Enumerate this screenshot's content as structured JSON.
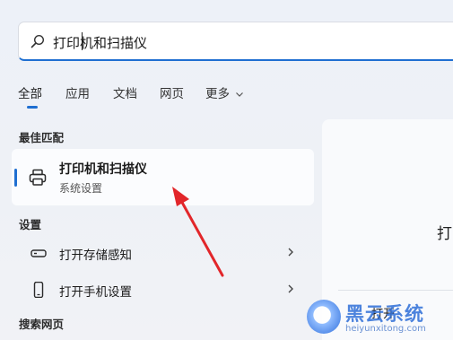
{
  "search": {
    "value": "打印机和扫描仪"
  },
  "tabs": [
    {
      "label": "全部",
      "active": true
    },
    {
      "label": "应用"
    },
    {
      "label": "文档"
    },
    {
      "label": "网页"
    },
    {
      "label": "更多"
    }
  ],
  "sections": {
    "best_match": "最佳匹配",
    "settings": "设置",
    "search_web": "搜索网页"
  },
  "best_match": {
    "title": "打印机和扫描仪",
    "subtitle": "系统设置",
    "icon": "printer-icon"
  },
  "settings_items": [
    {
      "label": "打开存储感知",
      "icon": "storage-icon"
    },
    {
      "label": "打开手机设置",
      "icon": "phone-icon"
    }
  ],
  "preview": {
    "title_fragment": "打",
    "action_label": "打开"
  },
  "watermark": {
    "title": "黑云系统",
    "url": "heiyunxitong.com"
  },
  "colors": {
    "accent": "#1f6fd1",
    "annotation_arrow": "#e2262a"
  }
}
